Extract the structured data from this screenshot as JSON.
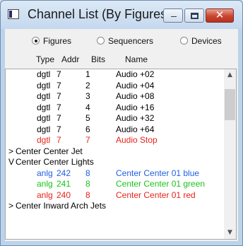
{
  "window": {
    "title": "Channel List (By Figures)"
  },
  "radios": [
    {
      "label": "Figures",
      "selected": true
    },
    {
      "label": "Sequencers",
      "selected": false
    },
    {
      "label": "Devices",
      "selected": false
    }
  ],
  "headers": {
    "type": "Type",
    "addr": "Addr",
    "bits": "Bits",
    "name": "Name"
  },
  "colors": {
    "black": "#000000",
    "red": "#e8231a",
    "blue": "#1f5fe0",
    "green": "#19c219"
  },
  "rows": [
    {
      "kind": "item",
      "type": "dgtl",
      "addr": "7",
      "bits": "1",
      "name": "Audio +02",
      "color": "black"
    },
    {
      "kind": "item",
      "type": "dgtl",
      "addr": "7",
      "bits": "2",
      "name": "Audio +04",
      "color": "black"
    },
    {
      "kind": "item",
      "type": "dgtl",
      "addr": "7",
      "bits": "3",
      "name": "Audio +08",
      "color": "black"
    },
    {
      "kind": "item",
      "type": "dgtl",
      "addr": "7",
      "bits": "4",
      "name": "Audio +16",
      "color": "black"
    },
    {
      "kind": "item",
      "type": "dgtl",
      "addr": "7",
      "bits": "5",
      "name": "Audio +32",
      "color": "black"
    },
    {
      "kind": "item",
      "type": "dgtl",
      "addr": "7",
      "bits": "6",
      "name": "Audio +64",
      "color": "black"
    },
    {
      "kind": "item",
      "type": "dgtl",
      "addr": "7",
      "bits": "7",
      "name": "Audio Stop",
      "color": "red"
    },
    {
      "kind": "group",
      "arrow": ">",
      "name": "Center Center Jet"
    },
    {
      "kind": "group",
      "arrow": "V",
      "name": "Center Center Lights"
    },
    {
      "kind": "item",
      "type": "anlg",
      "addr": "242",
      "bits": "8",
      "name": "Center Center 01 blue",
      "color": "blue"
    },
    {
      "kind": "item",
      "type": "anlg",
      "addr": "241",
      "bits": "8",
      "name": "Center Center 01 green",
      "color": "green"
    },
    {
      "kind": "item",
      "type": "anlg",
      "addr": "240",
      "bits": "8",
      "name": "Center Center 01 red",
      "color": "red"
    },
    {
      "kind": "group",
      "arrow": ">",
      "name": "Center Inward Arch Jets"
    }
  ]
}
